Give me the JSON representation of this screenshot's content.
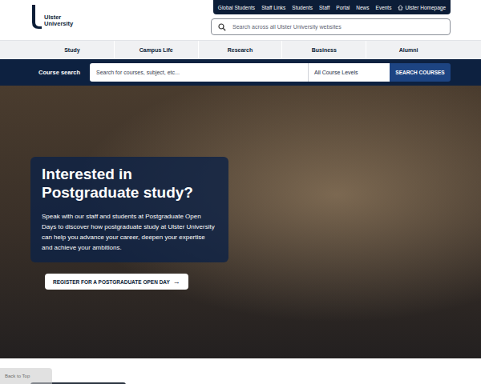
{
  "logo": {
    "line1": "Ulster",
    "line2": "University"
  },
  "utility_links": [
    {
      "label": "Global Students",
      "home": false
    },
    {
      "label": "Staff Links",
      "home": false
    },
    {
      "label": "Students",
      "home": false
    },
    {
      "label": "Staff",
      "home": false
    },
    {
      "label": "Portal",
      "home": false
    },
    {
      "label": "News",
      "home": false
    },
    {
      "label": "Events",
      "home": false
    },
    {
      "label": "Ulster Homepage",
      "home": true
    }
  ],
  "site_search": {
    "placeholder": "Search across all Ulster University websites"
  },
  "main_nav": [
    "Study",
    "Campus Life",
    "Research",
    "Business",
    "Alumni"
  ],
  "course_search": {
    "label": "Course search",
    "placeholder": "Search for courses, subject, etc...",
    "level_select": "All Course Levels",
    "button": "SEARCH COURSES"
  },
  "hero": {
    "title": "Interested in Postgraduate study?",
    "text": "Speak with our staff and students at Postgraduate Open Days to discover how postgraduate study at Ulster University can help you advance your career, deepen your expertise and achieve your ambitions.",
    "cta": "REGISTER FOR A POSTGRADUATE OPEN DAY",
    "cta_icon": "→"
  },
  "back_to_top": "Back to Top"
}
